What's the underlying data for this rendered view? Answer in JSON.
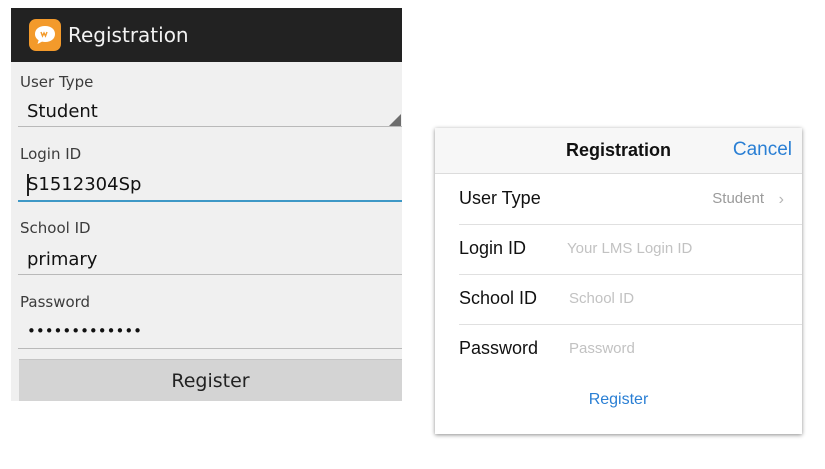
{
  "android": {
    "title": "Registration",
    "user_type": {
      "label": "User Type",
      "value": "Student"
    },
    "login_id": {
      "label": "Login ID",
      "value": "S1512304Sp"
    },
    "school_id": {
      "label": "School ID",
      "value": "primary"
    },
    "password": {
      "label": "Password",
      "value": "•••••••••••••"
    },
    "register_label": "Register",
    "colors": {
      "header": "#222222",
      "accent": "#3e98c6",
      "icon": "#f39a2b"
    }
  },
  "ios": {
    "title": "Registration",
    "cancel_label": "Cancel",
    "user_type": {
      "label": "User Type",
      "value": "Student"
    },
    "login_id": {
      "label": "Login ID",
      "placeholder": "Your LMS Login ID"
    },
    "school_id": {
      "label": "School ID",
      "placeholder": "School ID"
    },
    "password": {
      "label": "Password",
      "placeholder": "Password"
    },
    "register_label": "Register",
    "colors": {
      "tint": "#2a7fd4"
    }
  }
}
